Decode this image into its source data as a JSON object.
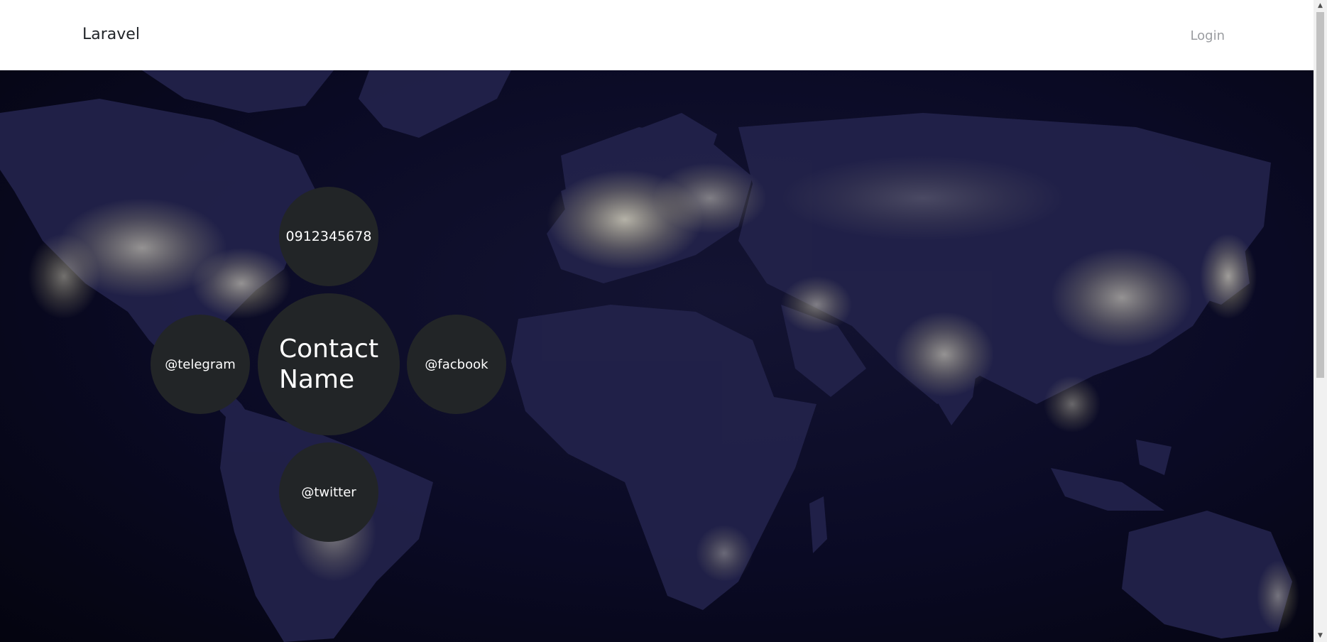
{
  "navbar": {
    "brand": "Laravel",
    "login": "Login"
  },
  "contact": {
    "name": "Contact Name",
    "phone": "0912345678",
    "telegram": "@telegram",
    "facebook": "@facbook",
    "twitter": "@twitter"
  },
  "icons": {
    "scroll_up": "scroll-up-arrow",
    "scroll_down": "scroll-down-arrow"
  },
  "colors": {
    "navbar_bg": "#ffffff",
    "circle_bg": "#222527",
    "map_bg": "#0a0a24",
    "city_lights": "#f4f0c8"
  }
}
